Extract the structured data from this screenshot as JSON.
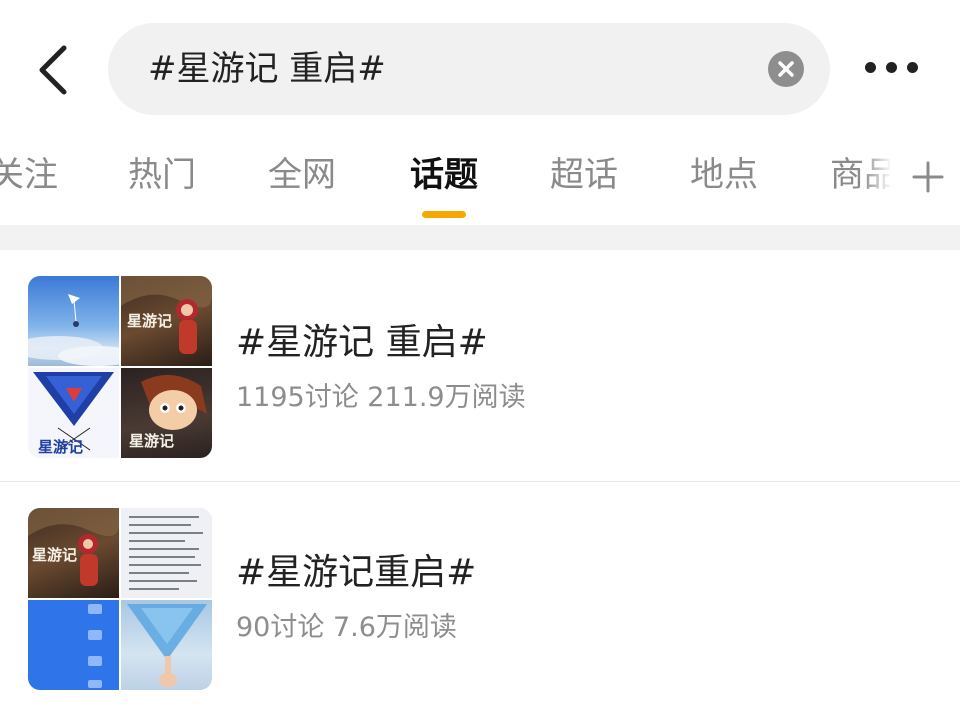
{
  "header": {
    "search_query": "#星游记 重启#"
  },
  "tabs": {
    "items": [
      {
        "label": "关注"
      },
      {
        "label": "热门"
      },
      {
        "label": "全网"
      },
      {
        "label": "话题",
        "active": true
      },
      {
        "label": "超话"
      },
      {
        "label": "地点"
      },
      {
        "label": "商品"
      }
    ]
  },
  "topics": [
    {
      "title": "#星游记 重启#",
      "stats": "1195讨论 211.9万阅读"
    },
    {
      "title": "#星游记重启#",
      "stats": "90讨论 7.6万阅读"
    }
  ],
  "colors": {
    "accent": "#f6a800",
    "search_bg": "#f1f1f1",
    "active_text": "#111111",
    "inactive_text": "#8a8a8a",
    "meta_text": "#8d8d8d"
  },
  "icons": {
    "back": "chevron-left-icon",
    "clear": "clear-circle-icon",
    "more": "more-horizontal-icon",
    "add": "plus-icon"
  },
  "thumbnail_logo_text": "星游记"
}
